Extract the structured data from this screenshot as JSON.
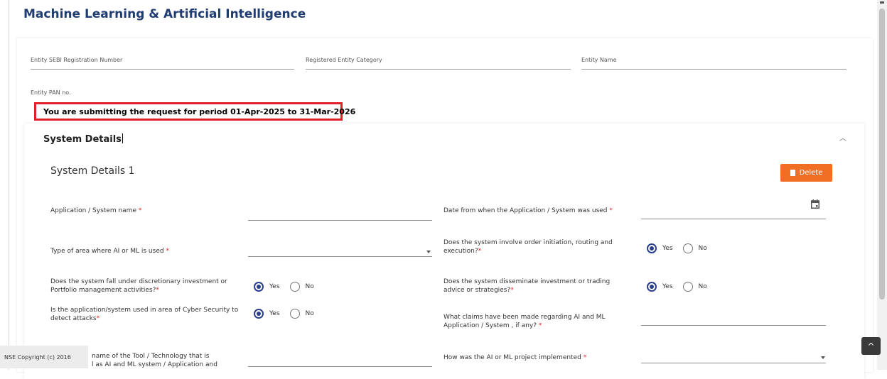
{
  "page": {
    "title": "Machine Learning & Artificial Intelligence"
  },
  "entity": {
    "sebi_label": "Entity SEBI Registration Number",
    "category_label": "Registered Entity Category",
    "name_label": "Entity Name",
    "pan_label": "Entity PAN no."
  },
  "period_notice": "You are submitting the request for period  01-Apr-2025 to 31-Mar-2026",
  "section": {
    "title": "System Details",
    "collapse_icon": "chevron-up-icon",
    "subsection_title": "System Details 1",
    "delete_label": "Delete"
  },
  "form": {
    "app_name_label": "Application / System name",
    "date_used_label": "Date from when the Application / System was used",
    "area_type_label": "Type of area where AI or ML is used",
    "order_initiation_label": "Does the system involve order initiation, routing and execution?",
    "discretionary_label": "Does the system fall under discretionary investment or Portfolio management activities?",
    "disseminate_label": "Does the system disseminate investment or trading advice or strategies?",
    "cyber_label": "Is the application/system used in area of Cyber Security to detect attacks",
    "claims_label": "What claims have been made regarding AI and ML Application / System , if any?",
    "tool_label_line1": "name of the Tool / Technology that is",
    "tool_label_line2": "l as AI and ML system / Application and",
    "implemented_label": "How was the AI or ML project implemented",
    "required_mark": "*",
    "yes_label": "Yes",
    "no_label": "No",
    "selected": {
      "order_initiation": "Yes",
      "discretionary": "Yes",
      "disseminate": "Yes",
      "cyber": "Yes"
    }
  },
  "footer": {
    "copyright": "NSE Copyright (c) 2016"
  },
  "scroll_top_label": "^",
  "colors": {
    "title": "#1f3c73",
    "delete": "#f06f25",
    "required": "#e0212b",
    "highlight": "#e0212b",
    "radio": "#2a3e8c"
  }
}
